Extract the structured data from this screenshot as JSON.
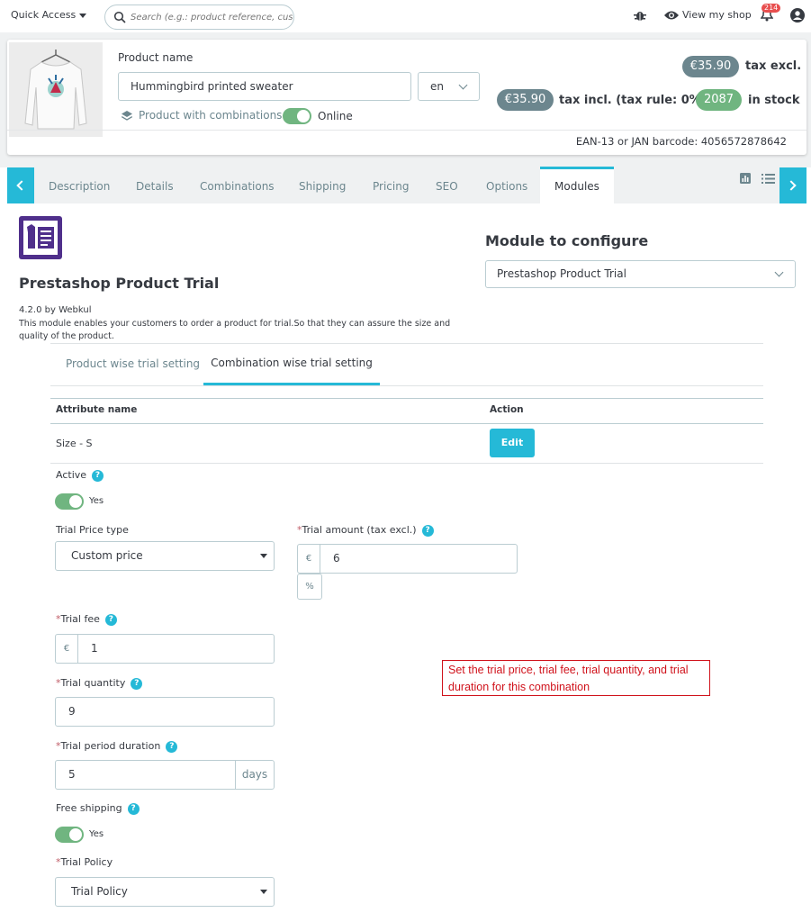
{
  "topbar": {
    "quick_access": "Quick Access",
    "search_placeholder": "Search (e.g.: product reference, custon",
    "view_shop": "View my shop",
    "notifications": "214"
  },
  "product": {
    "name_label": "Product name",
    "name": "Hummingbird printed sweater",
    "lang": "en",
    "combinations_label": "Product with combinations",
    "online_label": "Online",
    "price_excl": "€35.90",
    "price_excl_label": "tax excl.",
    "price_incl": "€35.90",
    "price_incl_label": "tax incl. (tax rule: 0%)",
    "stock": "2087",
    "stock_label": "in stock",
    "barcode": "EAN-13 or JAN barcode: 4056572878642"
  },
  "tabs": [
    "Description",
    "Details",
    "Combinations",
    "Shipping",
    "Pricing",
    "SEO",
    "Options",
    "Modules"
  ],
  "module": {
    "title": "Prestashop Product Trial",
    "version": "4.2.0 by Webkul",
    "description": "This module enables your customers to order a product for trial.So that they can assure the size and quality of the product.",
    "configure_label": "Module to configure",
    "configure_value": "Prestashop Product Trial"
  },
  "subtabs": [
    "Product wise trial setting",
    "Combination wise trial setting"
  ],
  "table": {
    "headers": [
      "Attribute name",
      "Action"
    ],
    "row": {
      "attribute": "Size - S",
      "action": "Edit"
    }
  },
  "form": {
    "active_label": "Active",
    "active_value": "Yes",
    "price_type_label": "Trial Price type",
    "price_type_value": "Custom price",
    "amount_label": "Trial amount (tax excl.)",
    "amount_currency": "€",
    "amount_value": "6",
    "amount_percent": "%",
    "fee_label": "Trial fee",
    "fee_currency": "€",
    "fee_value": "1",
    "quantity_label": "Trial quantity",
    "quantity_value": "9",
    "duration_label": "Trial period duration",
    "duration_value": "5",
    "duration_unit": "days",
    "free_shipping_label": "Free shipping",
    "free_shipping_value": "Yes",
    "policy_label": "Trial Policy",
    "policy_value": "Trial Policy",
    "required_mark": "*",
    "help_mark": "?"
  },
  "annotation": "Set the trial price, trial fee, trial quantity, and trial duration for this combination",
  "colors": {
    "accent": "#25b9d7",
    "success": "#70b580",
    "grey_pill": "#6c868e",
    "annotation": "#d0121b",
    "module_logo": "#4f2f8b"
  }
}
